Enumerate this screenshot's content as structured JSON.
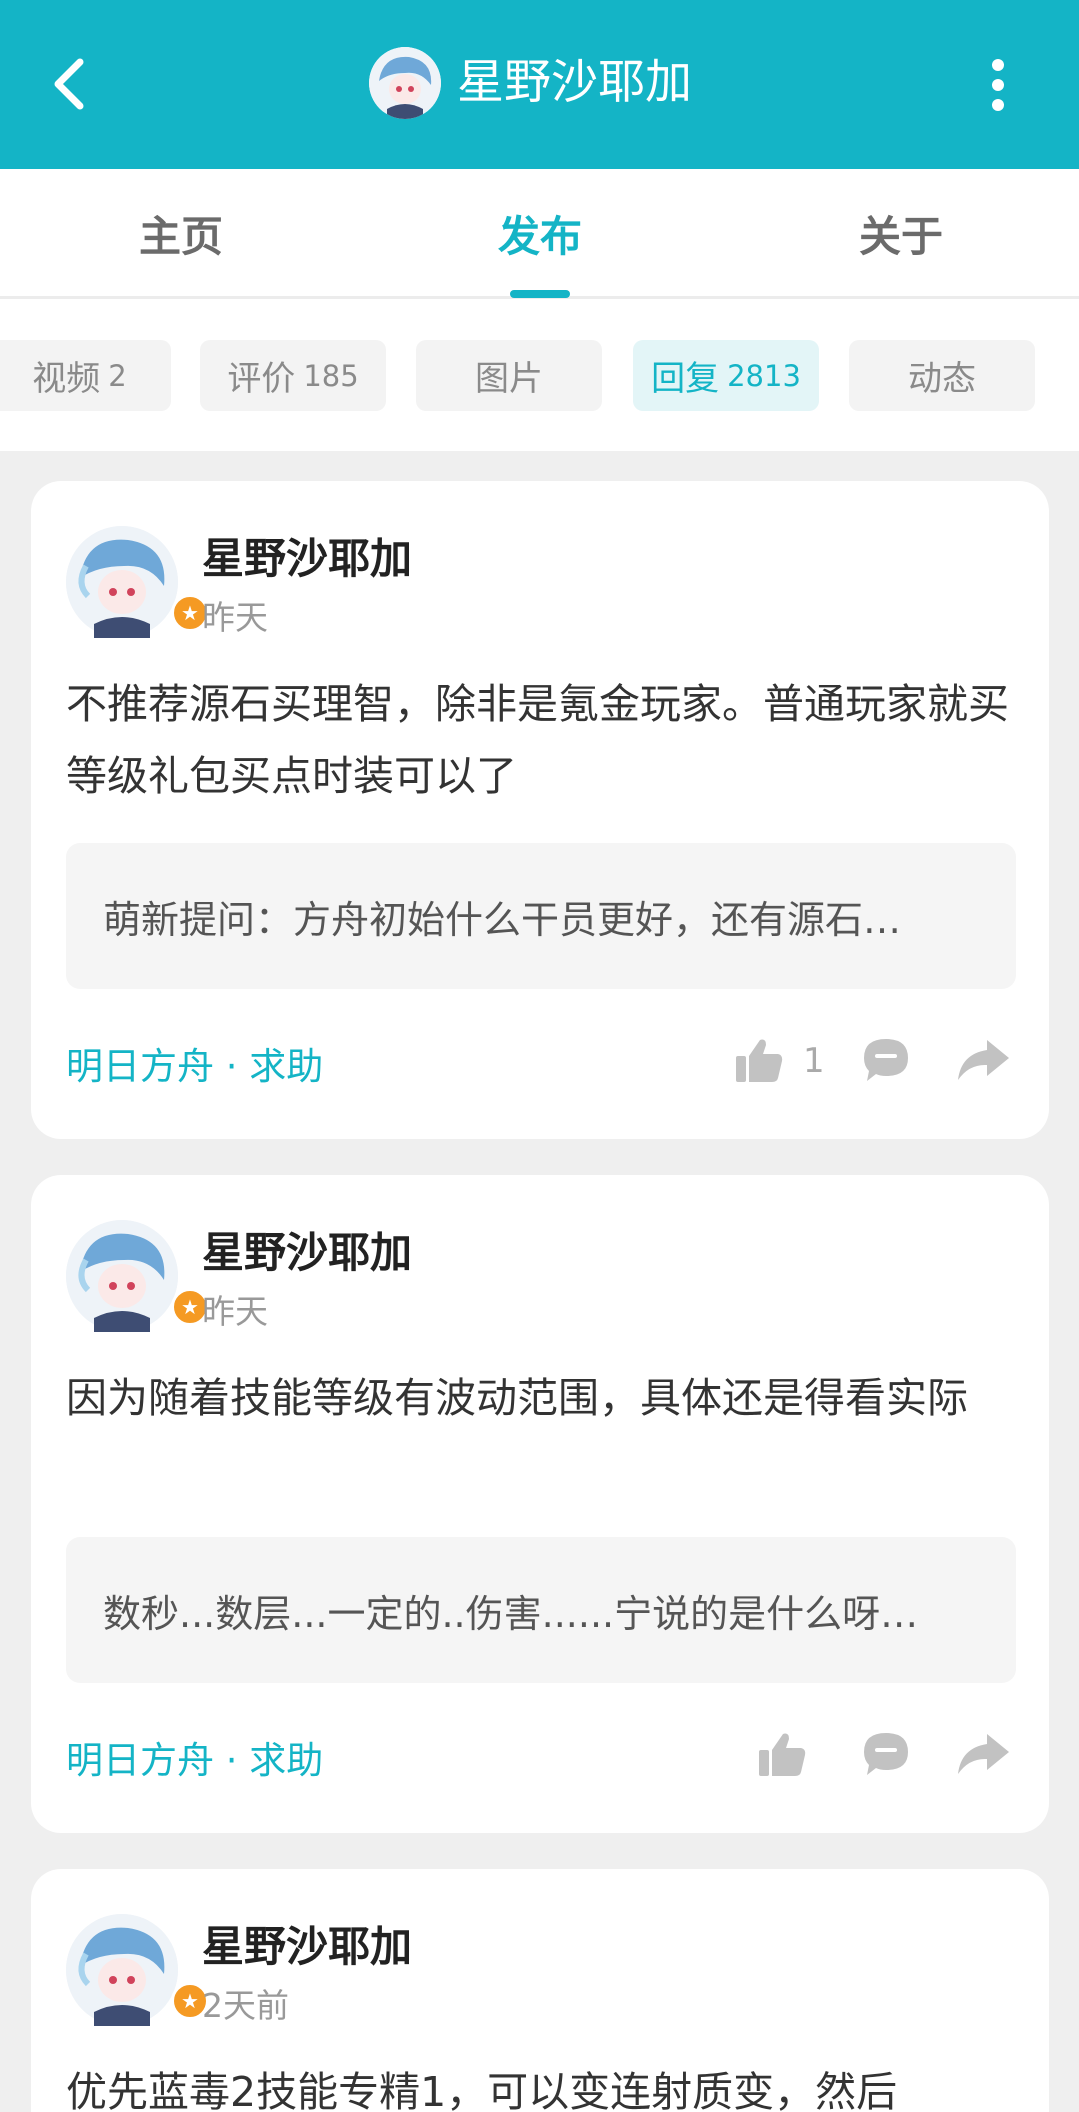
{
  "header": {
    "title": "星野沙耶加"
  },
  "tabs": [
    {
      "label": "主页"
    },
    {
      "label": "发布"
    },
    {
      "label": "关于"
    }
  ],
  "chips": [
    {
      "label": "视频",
      "count": "2"
    },
    {
      "label": "评价",
      "count": "185"
    },
    {
      "label": "图片",
      "count": ""
    },
    {
      "label": "回复",
      "count": "2813"
    },
    {
      "label": "动态",
      "count": ""
    }
  ],
  "posts": [
    {
      "user": "星野沙耶加",
      "time": "昨天",
      "content": "不推荐源石买理智，除非是氪金玩家。普通玩家就买等级礼包买点时装可以了",
      "quote": "萌新提问：方舟初始什么干员更好，还有源石…",
      "tag": "明日方舟 · 求助",
      "likes": "1"
    },
    {
      "user": "星野沙耶加",
      "time": "昨天",
      "content": "因为随着技能等级有波动范围，具体还是得看实际",
      "quote": "数秒...数层...一定的..伤害......宁说的是什么呀…",
      "tag": "明日方舟 · 求助",
      "likes": ""
    },
    {
      "user": "星野沙耶加",
      "time": "2天前",
      "content": "优先蓝毒2技能专精1，可以变连射质变，然后"
    }
  ],
  "colors": {
    "accent": "#14b4c6",
    "badge": "#f59a23"
  },
  "icons": {
    "back": "back-arrow-icon",
    "more": "more-vertical-icon",
    "like": "thumbs-up-icon",
    "comment": "comment-icon",
    "share": "share-icon",
    "badge": "star-badge-icon"
  }
}
